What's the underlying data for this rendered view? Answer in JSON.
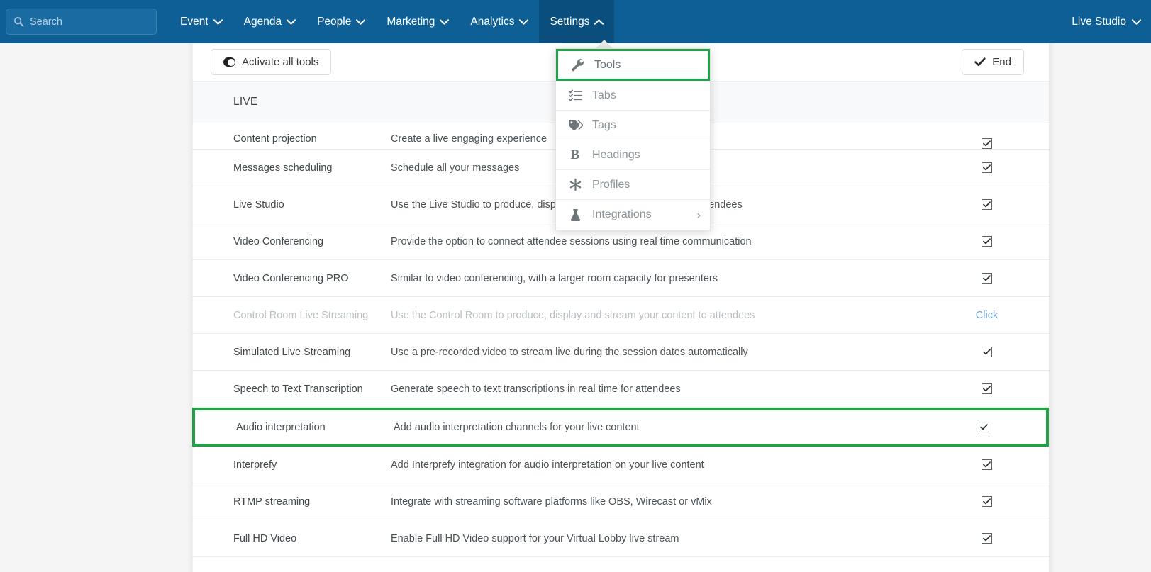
{
  "header": {
    "search": {
      "placeholder": "Search"
    },
    "nav": [
      {
        "label": "Event",
        "active": false
      },
      {
        "label": "Agenda",
        "active": false
      },
      {
        "label": "People",
        "active": false
      },
      {
        "label": "Marketing",
        "active": false
      },
      {
        "label": "Analytics",
        "active": false
      },
      {
        "label": "Settings",
        "active": true
      }
    ],
    "right": {
      "label": "Live Studio"
    },
    "colors": {
      "bar": "#0e5f95",
      "active_tab": "#0a4e7d"
    }
  },
  "dropdown": {
    "items": [
      {
        "label": "Tools",
        "icon": "wrench-icon",
        "highlighted": true,
        "submenu": false
      },
      {
        "label": "Tabs",
        "icon": "list-check-icon",
        "highlighted": false,
        "submenu": false
      },
      {
        "label": "Tags",
        "icon": "tag-icon",
        "highlighted": false,
        "submenu": false
      },
      {
        "label": "Headings",
        "icon": "bold-b-icon",
        "highlighted": false,
        "submenu": false
      },
      {
        "label": "Profiles",
        "icon": "asterisk-icon",
        "highlighted": false,
        "submenu": false
      },
      {
        "label": "Integrations",
        "icon": "flask-icon",
        "highlighted": false,
        "submenu": true
      }
    ],
    "submenu_chevron": "›",
    "highlight_color": "#22a04a"
  },
  "toolbar": {
    "activate_all_label": "Activate all tools",
    "end_label": "End"
  },
  "table": {
    "section_title": "LIVE",
    "highlight_color": "#22a04a",
    "rows": [
      {
        "name": "Content projection",
        "desc": "Create a live engaging experience",
        "action": "checkbox",
        "checked": true,
        "disabled": false,
        "highlighted": false,
        "clipped": true
      },
      {
        "name": "Messages scheduling",
        "desc": "Schedule all your messages",
        "action": "checkbox",
        "checked": true,
        "disabled": false,
        "highlighted": false,
        "clipped": false
      },
      {
        "name": "Live Studio",
        "desc": "Use the Live Studio to produce, display and stream your content to attendees",
        "action": "checkbox",
        "checked": true,
        "disabled": false,
        "highlighted": false,
        "clipped": false
      },
      {
        "name": "Video Conferencing",
        "desc": "Provide the option to connect attendee sessions using real time communication",
        "action": "checkbox",
        "checked": true,
        "disabled": false,
        "highlighted": false,
        "clipped": false
      },
      {
        "name": "Video Conferencing PRO",
        "desc": "Similar to video conferencing, with a larger room capacity for presenters",
        "action": "checkbox",
        "checked": true,
        "disabled": false,
        "highlighted": false,
        "clipped": false
      },
      {
        "name": "Control Room Live Streaming",
        "desc": "Use the Control Room to produce, display and stream your content to attendees",
        "action": "link",
        "link_label": "Click",
        "checked": false,
        "disabled": true,
        "highlighted": false,
        "clipped": false
      },
      {
        "name": "Simulated Live Streaming",
        "desc": "Use a pre-recorded video to stream live during the session dates automatically",
        "action": "checkbox",
        "checked": true,
        "disabled": false,
        "highlighted": false,
        "clipped": false
      },
      {
        "name": "Speech to Text Transcription",
        "desc": "Generate speech to text transcriptions in real time for attendees",
        "action": "checkbox",
        "checked": true,
        "disabled": false,
        "highlighted": false,
        "clipped": false
      },
      {
        "name": "Audio interpretation",
        "desc": "Add audio interpretation channels for your live content",
        "action": "checkbox",
        "checked": true,
        "disabled": false,
        "highlighted": true,
        "clipped": false
      },
      {
        "name": "Interprefy",
        "desc": "Add Interprefy integration for audio interpretation on your live content",
        "action": "checkbox",
        "checked": true,
        "disabled": false,
        "highlighted": false,
        "clipped": false
      },
      {
        "name": "RTMP streaming",
        "desc": "Integrate with streaming software platforms like OBS, Wirecast or vMix",
        "action": "checkbox",
        "checked": true,
        "disabled": false,
        "highlighted": false,
        "clipped": false
      },
      {
        "name": "Full HD Video",
        "desc": "Enable Full HD Video support for your Virtual Lobby live stream",
        "action": "checkbox",
        "checked": true,
        "disabled": false,
        "highlighted": false,
        "clipped": false
      }
    ]
  }
}
